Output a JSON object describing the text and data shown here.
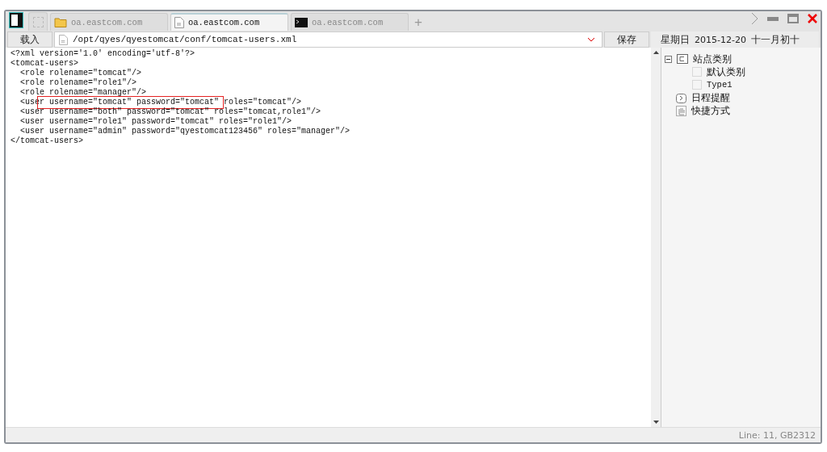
{
  "tabs": [
    {
      "label": "oa.eastcom.com",
      "kind": "folder",
      "selected": false
    },
    {
      "label": "oa.eastcom.com",
      "kind": "document",
      "selected": true
    },
    {
      "label": "oa.eastcom.com",
      "kind": "terminal",
      "selected": false
    }
  ],
  "new_tab": "+",
  "toolbar": {
    "load_button": "载入",
    "path": "/opt/qyes/qyestomcat/conf/tomcat-users.xml",
    "save_button": "保存"
  },
  "date": {
    "weekday": "星期日",
    "date": "2015-12-20",
    "lunar": "十一月初十"
  },
  "editor": {
    "lines": [
      {
        "before": "<?xml version='1.0' encoding='utf-8'?>"
      },
      {
        "before": "<tomcat-users>"
      },
      {
        "before": "  <role rolename=\"tomcat\"/>"
      },
      {
        "before": "  <role rolename=\"role1\"/>"
      },
      {
        "before": "  <role rolename=\"manager\"/>"
      },
      {
        "before": "  <use",
        "marked": "r username=\"tomcat\" password=\"tomcat\" ",
        "after": "roles=\"tomcat\"/>"
      },
      {
        "before": "  <user username=\"both\" password=\"tomcat\" roles=\"tomcat,role1\"/>"
      },
      {
        "before": "  <user username=\"role1\" password=\"tomcat\" roles=\"role1\"/>"
      },
      {
        "before": "  <user username=\"admin\" password=\"qyestomcat123456\" roles=\"manager\"/>"
      },
      {
        "before": "</tomcat-users>"
      }
    ]
  },
  "sidebar": {
    "tree": [
      {
        "label": "站点类别",
        "kind": "category",
        "expanded": true,
        "children": [
          {
            "label": "默认类别",
            "kind": "item"
          },
          {
            "label": "Type1",
            "kind": "item"
          }
        ]
      },
      {
        "label": "日程提醒",
        "kind": "reminder"
      },
      {
        "label": "快捷方式",
        "kind": "shortcut"
      }
    ]
  },
  "status_bar": {
    "text": "Line: 11, GB2312"
  }
}
